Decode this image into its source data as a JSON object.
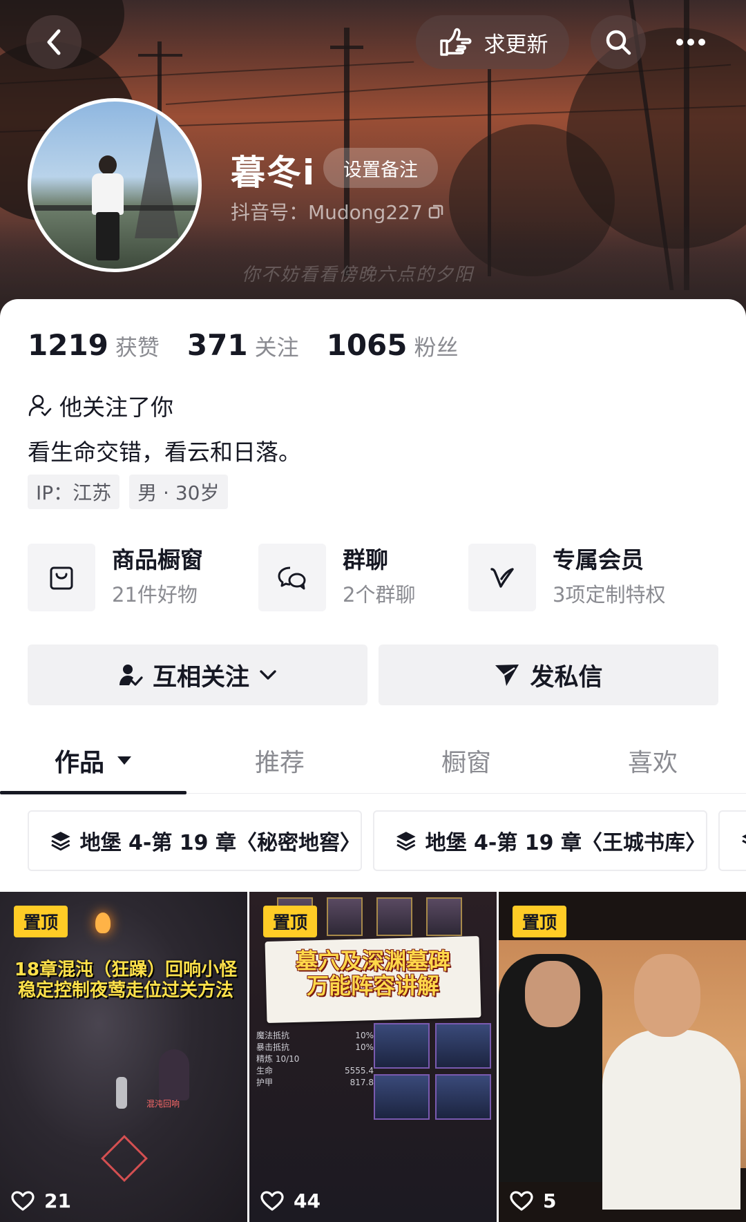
{
  "header": {
    "update_label": "求更新",
    "username": "暮冬i",
    "remark_label": "设置备注",
    "douyin_id": "抖音号：Mudong227",
    "cover_caption": "你不妨看看傍晚六点的夕阳"
  },
  "stats": [
    {
      "num": "1219",
      "label": "获赞"
    },
    {
      "num": "371",
      "label": "关注"
    },
    {
      "num": "1065",
      "label": "粉丝"
    }
  ],
  "profile": {
    "follows_you": "他关注了你",
    "bio": "看生命交错，看云和日落。",
    "tags": [
      "IP：江苏",
      "男 · 30岁"
    ]
  },
  "services": [
    {
      "title": "商品橱窗",
      "sub": "21件好物",
      "icon": "shopping-bag-icon"
    },
    {
      "title": "群聊",
      "sub": "2个群聊",
      "icon": "chat-bubbles-icon"
    },
    {
      "title": "专属会员",
      "sub": "3项定制特权",
      "icon": "vip-v-icon"
    }
  ],
  "actions": {
    "follow_label": "互相关注",
    "message_label": "发私信"
  },
  "tabs": [
    "作品",
    "推荐",
    "橱窗",
    "喜欢"
  ],
  "collections": [
    "地堡 4-第 19 章〈秘密地窖〉",
    "地堡 4-第 19 章〈王城书库〉"
  ],
  "videos": [
    {
      "pin": "置顶",
      "title_line1": "18章混沌（狂躁）回响小怪",
      "title_line2": "稳定控制夜莺走位过关方法",
      "likes": "21"
    },
    {
      "pin": "置顶",
      "title_line1": "墓穴及深渊墓碑",
      "title_line2": "万能阵容讲解",
      "likes": "44"
    },
    {
      "pin": "置顶",
      "likes": "5"
    }
  ],
  "colors": {
    "pin_badge": "#ffcc26",
    "text_primary": "#161823",
    "text_secondary": "#8a8b91"
  }
}
